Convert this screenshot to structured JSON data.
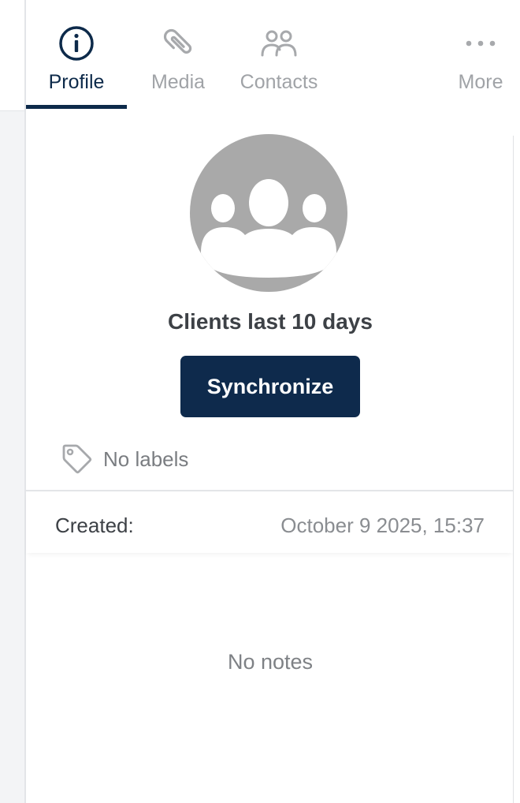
{
  "tabs": [
    {
      "label": "Profile",
      "icon": "info-icon",
      "active": true
    },
    {
      "label": "Media",
      "icon": "paperclip-icon",
      "active": false
    },
    {
      "label": "Contacts",
      "icon": "contacts-icon",
      "active": false
    },
    {
      "label": "More",
      "icon": "more-icon",
      "active": false
    }
  ],
  "profile": {
    "avatar_icon": "group-avatar-icon",
    "name": "Clients last 10 days",
    "sync_label": "Synchronize"
  },
  "labels": {
    "icon": "tag-icon",
    "text": "No labels"
  },
  "details": {
    "created_label": "Created:",
    "created_value": "October 9 2025, 15:37"
  },
  "notes": {
    "empty_text": "No notes"
  },
  "colors": {
    "accent": "#0e2a4c",
    "muted_icon": "#a7a9ac",
    "avatar_bg": "#a9a9a9"
  }
}
